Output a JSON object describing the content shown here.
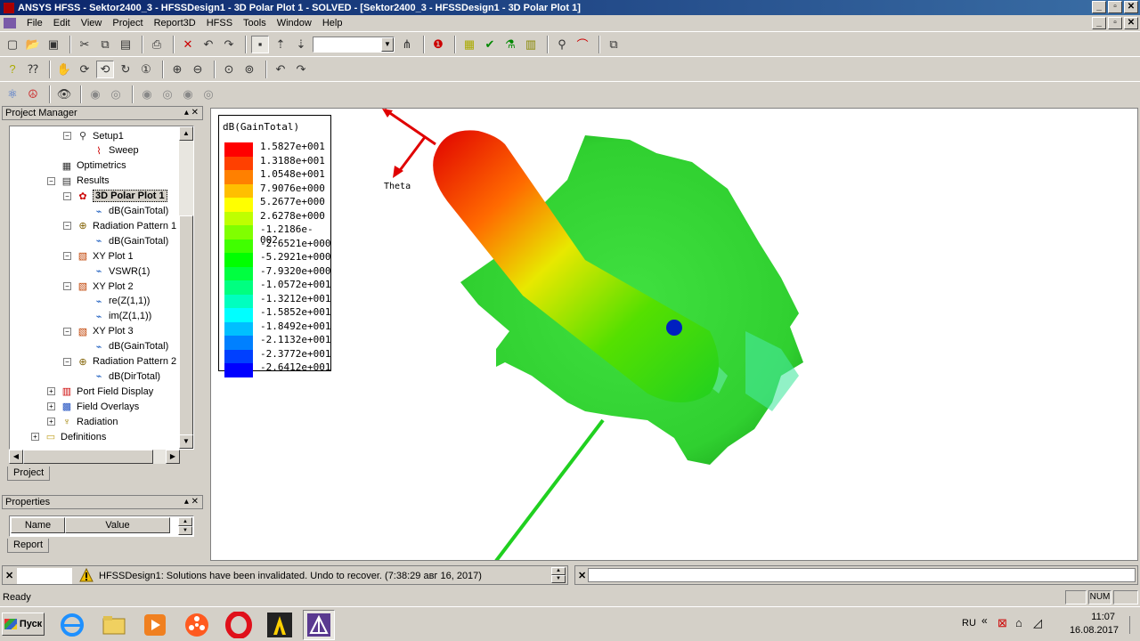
{
  "window": {
    "title": "ANSYS HFSS - Sektor2400_3 - HFSSDesign1 - 3D Polar Plot 1 - SOLVED - [Sektor2400_3 - HFSSDesign1 - 3D Polar Plot 1]",
    "minimize": "_",
    "maximize": "▫",
    "close": "✕"
  },
  "menu": {
    "items": [
      "File",
      "Edit",
      "View",
      "Project",
      "Report3D",
      "HFSS",
      "Tools",
      "Window",
      "Help"
    ]
  },
  "project_manager": {
    "title": "Project Manager",
    "controls": "▴ ✕",
    "tree": [
      {
        "label": "Setup1",
        "icon": "setup-icon",
        "indent": 1,
        "expander": "−"
      },
      {
        "label": "Sweep",
        "icon": "sweep-icon",
        "indent": 2,
        "expander": ""
      },
      {
        "label": "Optimetrics",
        "icon": "optimetrics-icon",
        "indent": 0,
        "expander": ""
      },
      {
        "label": "Results",
        "icon": "results-icon",
        "indent": 0,
        "expander": "−"
      },
      {
        "label": "3D Polar Plot 1",
        "icon": "polar-plot-icon",
        "indent": 1,
        "expander": "−",
        "selected": true
      },
      {
        "label": "dB(GainTotal)",
        "icon": "trace-icon",
        "indent": 2,
        "expander": ""
      },
      {
        "label": "Radiation Pattern 1",
        "icon": "radiation-pattern-icon",
        "indent": 1,
        "expander": "−"
      },
      {
        "label": "dB(GainTotal)",
        "icon": "trace-icon",
        "indent": 2,
        "expander": ""
      },
      {
        "label": "XY Plot 1",
        "icon": "xy-plot-icon",
        "indent": 1,
        "expander": "−"
      },
      {
        "label": "VSWR(1)",
        "icon": "trace-icon",
        "indent": 2,
        "expander": ""
      },
      {
        "label": "XY Plot 2",
        "icon": "xy-plot-icon",
        "indent": 1,
        "expander": "−"
      },
      {
        "label": "re(Z(1,1))",
        "icon": "trace-icon",
        "indent": 2,
        "expander": ""
      },
      {
        "label": "im(Z(1,1))",
        "icon": "trace-icon",
        "indent": 2,
        "expander": ""
      },
      {
        "label": "XY Plot 3",
        "icon": "xy-plot-icon",
        "indent": 1,
        "expander": "−"
      },
      {
        "label": "dB(GainTotal)",
        "icon": "trace-icon",
        "indent": 2,
        "expander": ""
      },
      {
        "label": "Radiation Pattern 2",
        "icon": "radiation-pattern-icon",
        "indent": 1,
        "expander": "−"
      },
      {
        "label": "dB(DirTotal)",
        "icon": "trace-icon",
        "indent": 2,
        "expander": ""
      },
      {
        "label": "Port Field Display",
        "icon": "port-field-icon",
        "indent": 0,
        "expander": "+"
      },
      {
        "label": "Field Overlays",
        "icon": "field-overlays-icon",
        "indent": 0,
        "expander": "+"
      },
      {
        "label": "Radiation",
        "icon": "radiation-icon",
        "indent": 0,
        "expander": "+"
      },
      {
        "label": "Definitions",
        "icon": "folder-icon",
        "indent": -1,
        "expander": "+"
      }
    ],
    "tab": "Project"
  },
  "properties": {
    "title": "Properties",
    "controls": "▴ ✕",
    "col_name": "Name",
    "col_value": "Value",
    "tab": "Report"
  },
  "plot": {
    "legend_title": "dB(GainTotal)",
    "legend": [
      {
        "value": "1.5827e+001",
        "color": "#ff0000"
      },
      {
        "value": "1.3188e+001",
        "color": "#ff4000"
      },
      {
        "value": "1.0548e+001",
        "color": "#ff8000"
      },
      {
        "value": "7.9076e+000",
        "color": "#ffbf00"
      },
      {
        "value": "5.2677e+000",
        "color": "#ffff00"
      },
      {
        "value": "2.6278e+000",
        "color": "#bfff00"
      },
      {
        "value": "-1.2186e-002",
        "color": "#80ff00"
      },
      {
        "value": "-2.6521e+000",
        "color": "#40ff00"
      },
      {
        "value": "-5.2921e+000",
        "color": "#00ff00"
      },
      {
        "value": "-7.9320e+000",
        "color": "#00ff40"
      },
      {
        "value": "-1.0572e+001",
        "color": "#00ff80"
      },
      {
        "value": "-1.3212e+001",
        "color": "#00ffbf"
      },
      {
        "value": "-1.5852e+001",
        "color": "#00ffff"
      },
      {
        "value": "-1.8492e+001",
        "color": "#00bfff"
      },
      {
        "value": "-2.1132e+001",
        "color": "#0080ff"
      },
      {
        "value": "-2.3772e+001",
        "color": "#0040ff"
      },
      {
        "value": "-2.6412e+001",
        "color": "#0000ff"
      }
    ],
    "axis_label": "Theta"
  },
  "messages": {
    "text": "HFSSDesign1: Solutions have been invalidated. Undo to recover. (7:38:29  авг 16, 2017)"
  },
  "status": {
    "ready": "Ready",
    "num": "NUM"
  },
  "taskbar": {
    "start": "Пуск",
    "lang": "RU",
    "time": "11:07",
    "date": "16.08.2017"
  }
}
